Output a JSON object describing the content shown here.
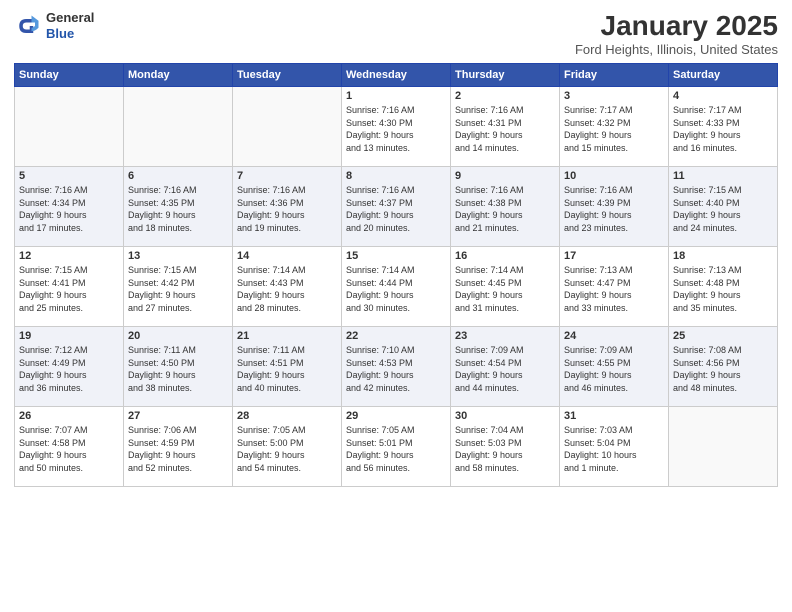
{
  "logo": {
    "line1": "General",
    "line2": "Blue"
  },
  "header": {
    "month": "January 2025",
    "location": "Ford Heights, Illinois, United States"
  },
  "weekdays": [
    "Sunday",
    "Monday",
    "Tuesday",
    "Wednesday",
    "Thursday",
    "Friday",
    "Saturday"
  ],
  "weeks": [
    [
      {
        "day": "",
        "detail": ""
      },
      {
        "day": "",
        "detail": ""
      },
      {
        "day": "",
        "detail": ""
      },
      {
        "day": "1",
        "detail": "Sunrise: 7:16 AM\nSunset: 4:30 PM\nDaylight: 9 hours\nand 13 minutes."
      },
      {
        "day": "2",
        "detail": "Sunrise: 7:16 AM\nSunset: 4:31 PM\nDaylight: 9 hours\nand 14 minutes."
      },
      {
        "day": "3",
        "detail": "Sunrise: 7:17 AM\nSunset: 4:32 PM\nDaylight: 9 hours\nand 15 minutes."
      },
      {
        "day": "4",
        "detail": "Sunrise: 7:17 AM\nSunset: 4:33 PM\nDaylight: 9 hours\nand 16 minutes."
      }
    ],
    [
      {
        "day": "5",
        "detail": "Sunrise: 7:16 AM\nSunset: 4:34 PM\nDaylight: 9 hours\nand 17 minutes."
      },
      {
        "day": "6",
        "detail": "Sunrise: 7:16 AM\nSunset: 4:35 PM\nDaylight: 9 hours\nand 18 minutes."
      },
      {
        "day": "7",
        "detail": "Sunrise: 7:16 AM\nSunset: 4:36 PM\nDaylight: 9 hours\nand 19 minutes."
      },
      {
        "day": "8",
        "detail": "Sunrise: 7:16 AM\nSunset: 4:37 PM\nDaylight: 9 hours\nand 20 minutes."
      },
      {
        "day": "9",
        "detail": "Sunrise: 7:16 AM\nSunset: 4:38 PM\nDaylight: 9 hours\nand 21 minutes."
      },
      {
        "day": "10",
        "detail": "Sunrise: 7:16 AM\nSunset: 4:39 PM\nDaylight: 9 hours\nand 23 minutes."
      },
      {
        "day": "11",
        "detail": "Sunrise: 7:15 AM\nSunset: 4:40 PM\nDaylight: 9 hours\nand 24 minutes."
      }
    ],
    [
      {
        "day": "12",
        "detail": "Sunrise: 7:15 AM\nSunset: 4:41 PM\nDaylight: 9 hours\nand 25 minutes."
      },
      {
        "day": "13",
        "detail": "Sunrise: 7:15 AM\nSunset: 4:42 PM\nDaylight: 9 hours\nand 27 minutes."
      },
      {
        "day": "14",
        "detail": "Sunrise: 7:14 AM\nSunset: 4:43 PM\nDaylight: 9 hours\nand 28 minutes."
      },
      {
        "day": "15",
        "detail": "Sunrise: 7:14 AM\nSunset: 4:44 PM\nDaylight: 9 hours\nand 30 minutes."
      },
      {
        "day": "16",
        "detail": "Sunrise: 7:14 AM\nSunset: 4:45 PM\nDaylight: 9 hours\nand 31 minutes."
      },
      {
        "day": "17",
        "detail": "Sunrise: 7:13 AM\nSunset: 4:47 PM\nDaylight: 9 hours\nand 33 minutes."
      },
      {
        "day": "18",
        "detail": "Sunrise: 7:13 AM\nSunset: 4:48 PM\nDaylight: 9 hours\nand 35 minutes."
      }
    ],
    [
      {
        "day": "19",
        "detail": "Sunrise: 7:12 AM\nSunset: 4:49 PM\nDaylight: 9 hours\nand 36 minutes."
      },
      {
        "day": "20",
        "detail": "Sunrise: 7:11 AM\nSunset: 4:50 PM\nDaylight: 9 hours\nand 38 minutes."
      },
      {
        "day": "21",
        "detail": "Sunrise: 7:11 AM\nSunset: 4:51 PM\nDaylight: 9 hours\nand 40 minutes."
      },
      {
        "day": "22",
        "detail": "Sunrise: 7:10 AM\nSunset: 4:53 PM\nDaylight: 9 hours\nand 42 minutes."
      },
      {
        "day": "23",
        "detail": "Sunrise: 7:09 AM\nSunset: 4:54 PM\nDaylight: 9 hours\nand 44 minutes."
      },
      {
        "day": "24",
        "detail": "Sunrise: 7:09 AM\nSunset: 4:55 PM\nDaylight: 9 hours\nand 46 minutes."
      },
      {
        "day": "25",
        "detail": "Sunrise: 7:08 AM\nSunset: 4:56 PM\nDaylight: 9 hours\nand 48 minutes."
      }
    ],
    [
      {
        "day": "26",
        "detail": "Sunrise: 7:07 AM\nSunset: 4:58 PM\nDaylight: 9 hours\nand 50 minutes."
      },
      {
        "day": "27",
        "detail": "Sunrise: 7:06 AM\nSunset: 4:59 PM\nDaylight: 9 hours\nand 52 minutes."
      },
      {
        "day": "28",
        "detail": "Sunrise: 7:05 AM\nSunset: 5:00 PM\nDaylight: 9 hours\nand 54 minutes."
      },
      {
        "day": "29",
        "detail": "Sunrise: 7:05 AM\nSunset: 5:01 PM\nDaylight: 9 hours\nand 56 minutes."
      },
      {
        "day": "30",
        "detail": "Sunrise: 7:04 AM\nSunset: 5:03 PM\nDaylight: 9 hours\nand 58 minutes."
      },
      {
        "day": "31",
        "detail": "Sunrise: 7:03 AM\nSunset: 5:04 PM\nDaylight: 10 hours\nand 1 minute."
      },
      {
        "day": "",
        "detail": ""
      }
    ]
  ]
}
